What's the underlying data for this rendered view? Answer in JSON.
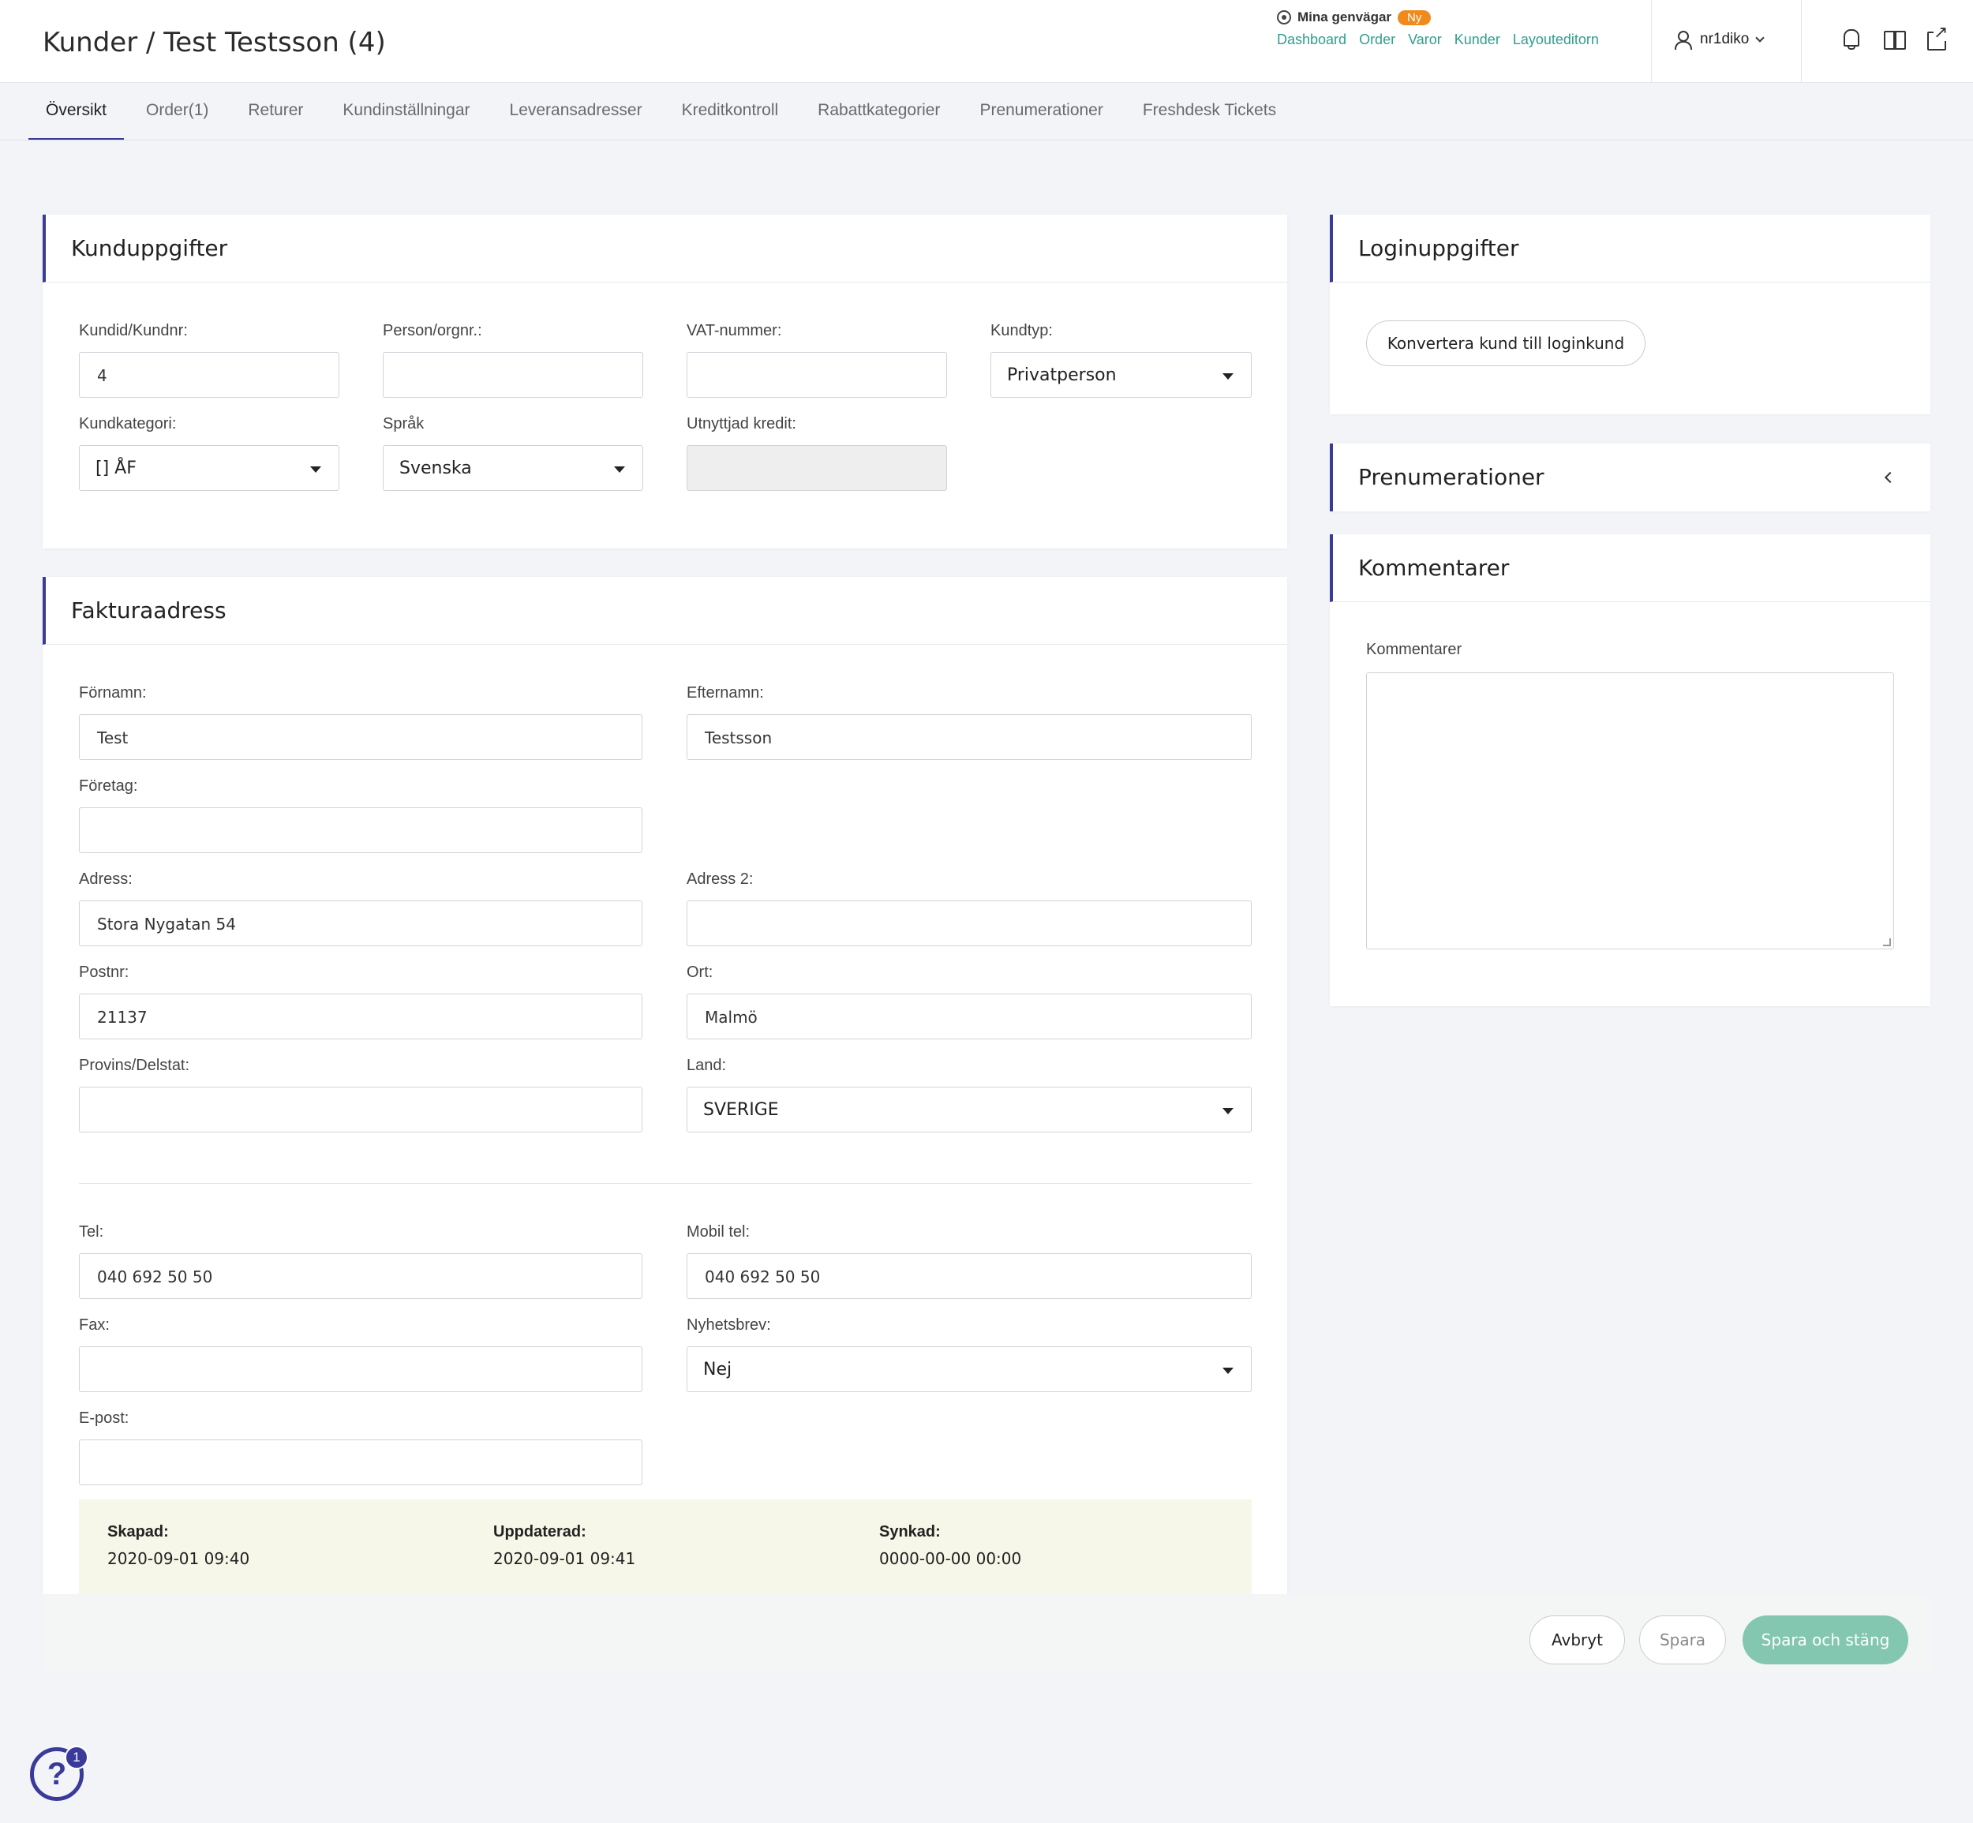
{
  "header": {
    "title": "Kunder / Test Testsson (4)",
    "shortcuts_title": "Mina genvägar",
    "shortcuts_badge": "Ny",
    "shortcuts": [
      "Dashboard",
      "Order",
      "Varor",
      "Kunder",
      "Layouteditorn"
    ],
    "username": "nr1diko"
  },
  "tabs": [
    "Översikt",
    "Order(1)",
    "Returer",
    "Kundinställningar",
    "Leveransadresser",
    "Kreditkontroll",
    "Rabattkategorier",
    "Prenumerationer",
    "Freshdesk Tickets"
  ],
  "kunduppgifter": {
    "title": "Kunduppgifter",
    "kundid_label": "Kundid/Kundnr:",
    "kundid_value": "4",
    "person_label": "Person/orgnr.:",
    "person_value": "",
    "vat_label": "VAT-nummer:",
    "vat_value": "",
    "kundtyp_label": "Kundtyp:",
    "kundtyp_value": "Privatperson",
    "kundkategori_label": "Kundkategori:",
    "kundkategori_value": "[] ÅF",
    "sprak_label": "Språk",
    "sprak_value": "Svenska",
    "kredit_label": "Utnyttjad kredit:",
    "kredit_value": ""
  },
  "faktura": {
    "title": "Fakturaadress",
    "fornamn_label": "Förnamn:",
    "fornamn_value": "Test",
    "efternamn_label": "Efternamn:",
    "efternamn_value": "Testsson",
    "foretag_label": "Företag:",
    "foretag_value": "",
    "adress_label": "Adress:",
    "adress_value": "Stora Nygatan 54",
    "adress2_label": "Adress 2:",
    "adress2_value": "",
    "postnr_label": "Postnr:",
    "postnr_value": "21137",
    "ort_label": "Ort:",
    "ort_value": "Malmö",
    "provins_label": "Provins/Delstat:",
    "provins_value": "",
    "land_label": "Land:",
    "land_value": "SVERIGE",
    "tel_label": "Tel:",
    "tel_value": "040 692 50 50",
    "mobil_label": "Mobil tel:",
    "mobil_value": "040 692 50 50",
    "fax_label": "Fax:",
    "fax_value": "",
    "nyhetsbrev_label": "Nyhetsbrev:",
    "nyhetsbrev_value": "Nej",
    "epost_label": "E-post:",
    "epost_value": ""
  },
  "meta": {
    "skapad_label": "Skapad:",
    "skapad_value": "2020-09-01 09:40",
    "uppdaterad_label": "Uppdaterad:",
    "uppdaterad_value": "2020-09-01 09:41",
    "synkad_label": "Synkad:",
    "synkad_value": "0000-00-00 00:00"
  },
  "login": {
    "title": "Loginuppgifter",
    "convert_button": "Konvertera kund till loginkund"
  },
  "prenumerationer": {
    "title": "Prenumerationer"
  },
  "kommentarer": {
    "title": "Kommentarer",
    "label": "Kommentarer"
  },
  "footer": {
    "cancel": "Avbryt",
    "save": "Spara",
    "save_close": "Spara och stäng"
  },
  "help": {
    "icon": "?",
    "badge": "1"
  },
  "colors": {
    "accent": "#3a3a9a",
    "link": "#2f9e8f",
    "badge": "#f08a1c",
    "primary_button": "#83c7b0"
  }
}
